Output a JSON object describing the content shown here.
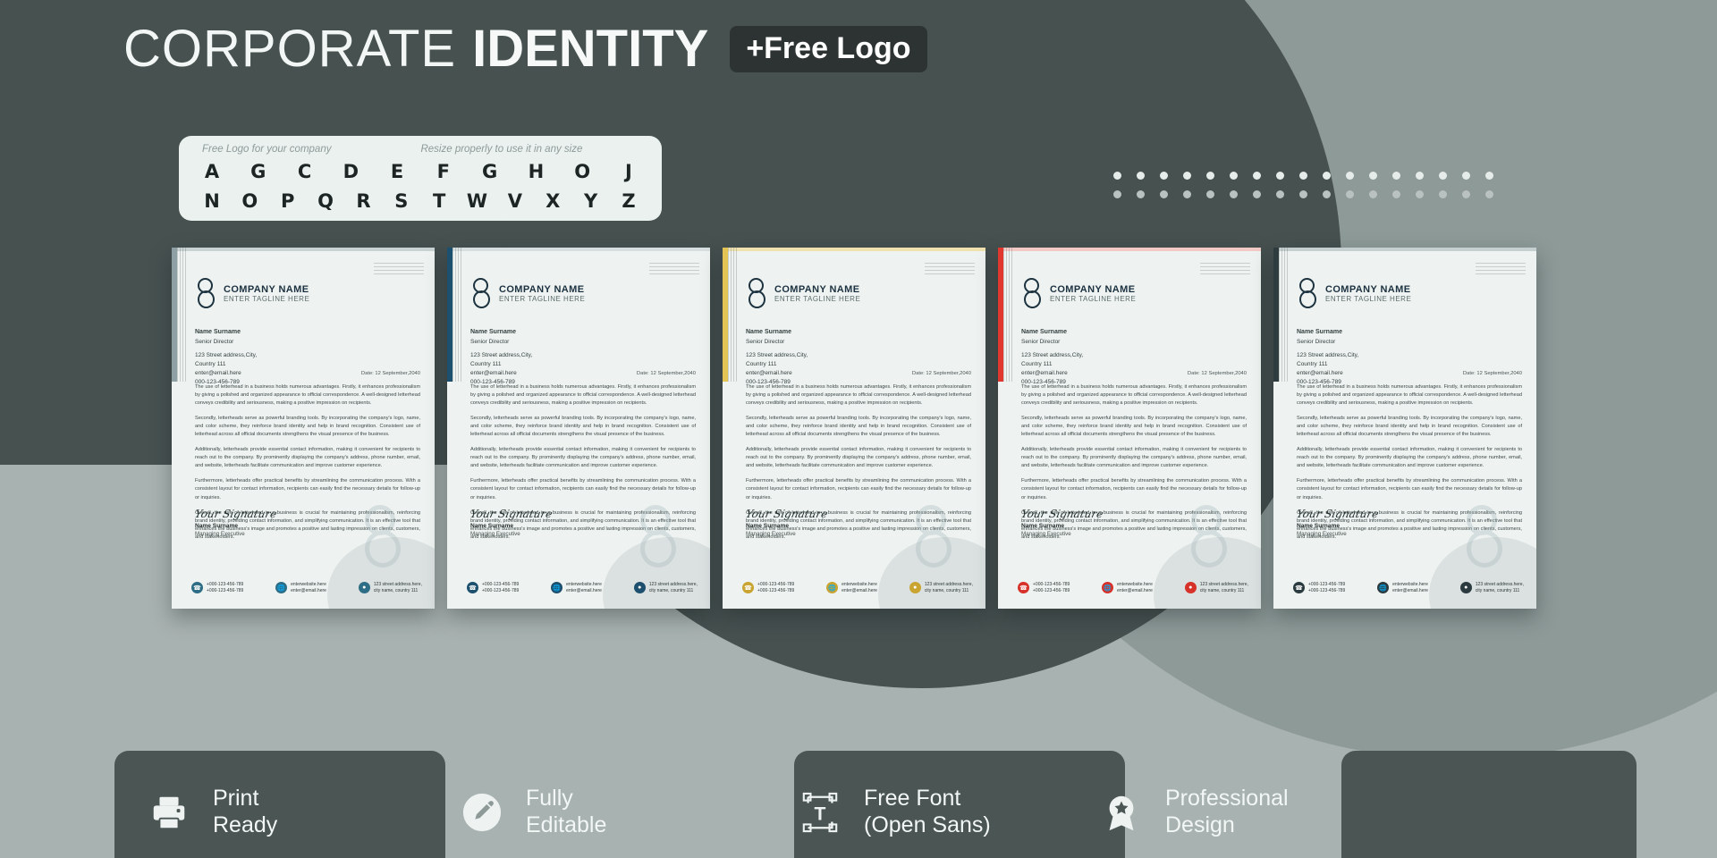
{
  "header": {
    "title_thin": "CORPORATE",
    "title_bold": "IDENTITY",
    "badge": "+Free Logo"
  },
  "logo_panel": {
    "label_left": "Free Logo for your company",
    "label_right": "Resize properly to use it in any size",
    "row1": [
      "A",
      "G",
      "C",
      "D",
      "E",
      "F",
      "G",
      "H",
      "O",
      "J"
    ],
    "row2": [
      "N",
      "O",
      "P",
      "Q",
      "R",
      "S",
      "T",
      "W",
      "V",
      "X",
      "Y",
      "Z"
    ]
  },
  "sheet_common": {
    "company_name": "COMPANY NAME",
    "tagline": "ENTER TAGLINE HERE",
    "recipient_name": "Name Surname",
    "recipient_role": "Senior Director",
    "address_line1": "123 Street address,City,",
    "address_line2": "Country 111",
    "address_email": "enter@email.here",
    "address_phone": "000-123-456-789",
    "date": "Date: 12 September,2040",
    "para1": "The use of letterhead in a business holds numerous advantages. Firstly, it enhances professionalism by giving a polished and organized appearance to official correspondence. A well-designed letterhead conveys credibility and seriousness, making a positive impression on recipients.",
    "para2": "Secondly, letterheads serve as powerful branding tools. By incorporating the company's logo, name, and color scheme, they reinforce brand identity and help in brand recognition. Consistent use of letterhead across all official documents strengthens the visual presence of the business.",
    "para3": "Additionally, letterheads provide essential contact information, making it convenient for recipients to reach out to the company. By prominently displaying the company's address, phone number, email, and website, letterheads facilitate communication and improve customer experience.",
    "para4": "Furthermore, letterheads offer practical benefits by streamlining the communication process. With a consistent layout for contact information, recipients can easily find the necessary details for follow-up or inquiries.",
    "para5": "Overall, the use of letterhead in a business is crucial for maintaining professionalism, reinforcing brand identity, providing contact information, and simplifying communication. It is an effective tool that enhances the business's image and promotes a positive and lasting impression on clients, customers, and stakeholders.",
    "signature_script": "Your Signature",
    "signature_name": "Name Surname",
    "signature_role": "Managing Executive",
    "contact_phone_1": "+000-123-456-789",
    "contact_phone_2": "+000-123-456-789",
    "contact_web": "enterwebsite.here",
    "contact_mail": "enter@email.here",
    "contact_addr_1": "123 street address.here,",
    "contact_addr_2": "city name, country 111",
    "icon_phone": "phone-icon",
    "icon_globe": "globe-icon",
    "icon_pin": "location-pin-icon"
  },
  "sheets": [
    {
      "id": "sheet-gray",
      "accent": "#8fa0a4",
      "accent2": "#c9d2d3",
      "phone_color": "#2e6d86",
      "web_color": "#2e6d86",
      "pin_color": "#2e6d86"
    },
    {
      "id": "sheet-navy",
      "accent": "#1d4f6e",
      "accent2": "#d6dee0",
      "phone_color": "#1d4f6e",
      "web_color": "#1d4f6e",
      "pin_color": "#1d4f6e"
    },
    {
      "id": "sheet-gold",
      "accent": "#e3c353",
      "accent2": "#efe2ae",
      "phone_color": "#c9a431",
      "web_color": "#c9a431",
      "pin_color": "#c9a431"
    },
    {
      "id": "sheet-red",
      "accent": "#e0382f",
      "accent2": "#f3c9c6",
      "phone_color": "#d6322a",
      "web_color": "#d6322a",
      "pin_color": "#d6322a"
    },
    {
      "id": "sheet-slate",
      "accent": "#2f3c3f",
      "accent2": "#c6cfd0",
      "phone_color": "#2a3a3e",
      "web_color": "#2a3a3e",
      "pin_color": "#2a3a3e"
    }
  ],
  "features": [
    {
      "icon": "printer-icon",
      "line1": "Print",
      "line2": "Ready"
    },
    {
      "icon": "pencil-icon",
      "line1": "Fully",
      "line2": "Editable"
    },
    {
      "icon": "text-font-icon",
      "line1": "Free Font",
      "line2": "(Open Sans)"
    },
    {
      "icon": "badge-icon",
      "line1": "Professional",
      "line2": "Design"
    }
  ],
  "colors": {
    "background": "#a8b2b0",
    "dark_panel": "#465150",
    "grey_circle": "#8d9a98",
    "sheet_paper": "#eef3f1",
    "badge_bg": "#2d3332"
  }
}
